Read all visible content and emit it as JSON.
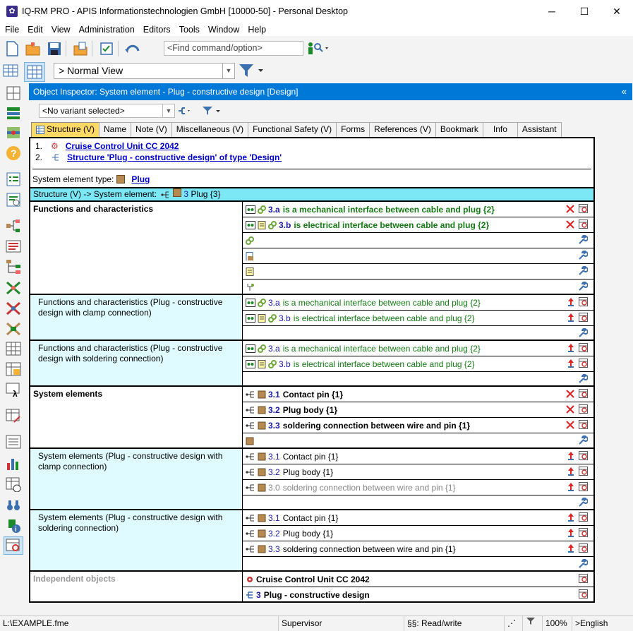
{
  "window": {
    "title": "IQ-RM PRO  - APIS Informationstechnologien GmbH [10000-50] - Personal Desktop"
  },
  "menu": [
    "File",
    "Edit",
    "View",
    "Administration",
    "Editors",
    "Tools",
    "Window",
    "Help"
  ],
  "toolbar": {
    "find_placeholder": "<Find command/option>"
  },
  "view": {
    "selected": "> Normal View"
  },
  "inspector": {
    "title": "Object Inspector: System element - Plug - constructive design [Design]",
    "variant": "<No variant selected>"
  },
  "tabs": [
    "Structure (V)",
    "Name",
    "Note (V)",
    "Miscellaneous (V)",
    "Functional Safety (V)",
    "Forms",
    "References (V)",
    "Bookmark",
    "Info",
    "Assistant"
  ],
  "doc": {
    "item1_num": "1.",
    "item1": "Cruise Control Unit CC 2042",
    "item2_num": "2.",
    "item2": "Structure 'Plug - constructive design' of type 'Design'",
    "type_label": "System element type:",
    "type_value": "Plug"
  },
  "structure_bar": {
    "prefix": "Structure (V) -> System element:",
    "num": "3",
    "name": "Plug {3}"
  },
  "sections": [
    {
      "label": "Functions and characteristics",
      "rows": [
        {
          "num": "3.a",
          "text": "is a mechanical interface between cable and plug {2}"
        },
        {
          "num": "3.b",
          "text": "is electrical interface between cable and plug {2}"
        }
      ]
    },
    {
      "label": "Functions and characteristics (Plug - constructive design with clamp connection)",
      "rows": [
        {
          "num": "3.a",
          "text": "is a mechanical interface between cable and plug {2}"
        },
        {
          "num": "3.b",
          "text": "is electrical interface between cable and plug {2}"
        }
      ]
    },
    {
      "label": "Functions and characteristics (Plug - constructive design with soldering connection)",
      "rows": [
        {
          "num": "3.a",
          "text": "is a mechanical interface between cable and plug {2}"
        },
        {
          "num": "3.b",
          "text": "is electrical interface between cable and plug {2}"
        }
      ]
    },
    {
      "label": "System elements",
      "rows": [
        {
          "num": "3.1",
          "text": "Contact pin {1}"
        },
        {
          "num": "3.2",
          "text": "Plug body {1}"
        },
        {
          "num": "3.3",
          "text": "soldering connection between wire and pin {1}"
        }
      ]
    },
    {
      "label": "System elements (Plug - constructive design with clamp connection)",
      "rows": [
        {
          "num": "3.1",
          "text": "Contact pin {1}"
        },
        {
          "num": "3.2",
          "text": "Plug body {1}"
        },
        {
          "num": "3.0",
          "text": "soldering connection between wire and pin {1}"
        }
      ]
    },
    {
      "label": "System elements (Plug - constructive design with soldering connection)",
      "rows": [
        {
          "num": "3.1",
          "text": "Contact pin {1}"
        },
        {
          "num": "3.2",
          "text": "Plug body {1}"
        },
        {
          "num": "3.3",
          "text": "soldering connection between wire and pin {1}"
        }
      ]
    },
    {
      "label": "Independent objects",
      "rows": [
        {
          "num": "",
          "text": "Cruise Control Unit CC 2042"
        },
        {
          "num": "3",
          "text": "Plug - constructive design"
        }
      ]
    }
  ],
  "status": {
    "file": "L:\\EXAMPLE.fme",
    "user": "Supervisor",
    "mode": "§§: Read/write",
    "zoom": "100%",
    "lang": ">English"
  }
}
